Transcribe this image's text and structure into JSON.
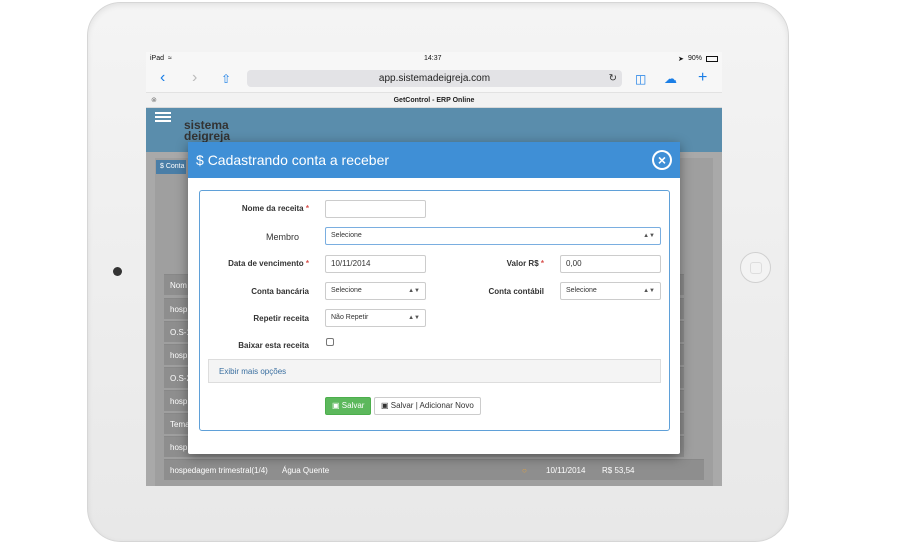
{
  "status_bar": {
    "carrier": "iPad",
    "time": "14:37",
    "battery": "90%"
  },
  "browser": {
    "url": "app.sistemadeigreja.com",
    "tab_title": "GetControl - ERP Online"
  },
  "app": {
    "logo_line1": "sistema",
    "logo_line2": "deigreja",
    "bg_rows": [
      "Nom",
      "hosp",
      "O.S-1",
      "hosp",
      "O.S-2",
      "hosp",
      "Tema",
      "hosp"
    ],
    "last_row": {
      "name": "hospedagem trimestral(1/4)",
      "desc": "Água Quente",
      "date": "10/11/2014",
      "value": "R$ 53,54"
    }
  },
  "modal": {
    "title": "Cadastrando conta a receber",
    "fields": {
      "nome_label": "Nome da receita",
      "nome_value": "",
      "membro_label": "Membro",
      "membro_value": "Selecione",
      "vencimento_label": "Data de vencimento",
      "vencimento_value": "10/11/2014",
      "valor_label": "Valor R$",
      "valor_value": "0,00",
      "conta_bancaria_label": "Conta bancária",
      "conta_bancaria_value": "Selecione",
      "conta_contabil_label": "Conta contábil",
      "conta_contabil_value": "Selecione",
      "repetir_label": "Repetir receita",
      "repetir_value": "Não Repetir",
      "baixar_label": "Baixar esta receita"
    },
    "more_options": "Exibir mais opções",
    "save_label": "Salvar",
    "save_add_label": "Salvar | Adicionar Novo"
  }
}
